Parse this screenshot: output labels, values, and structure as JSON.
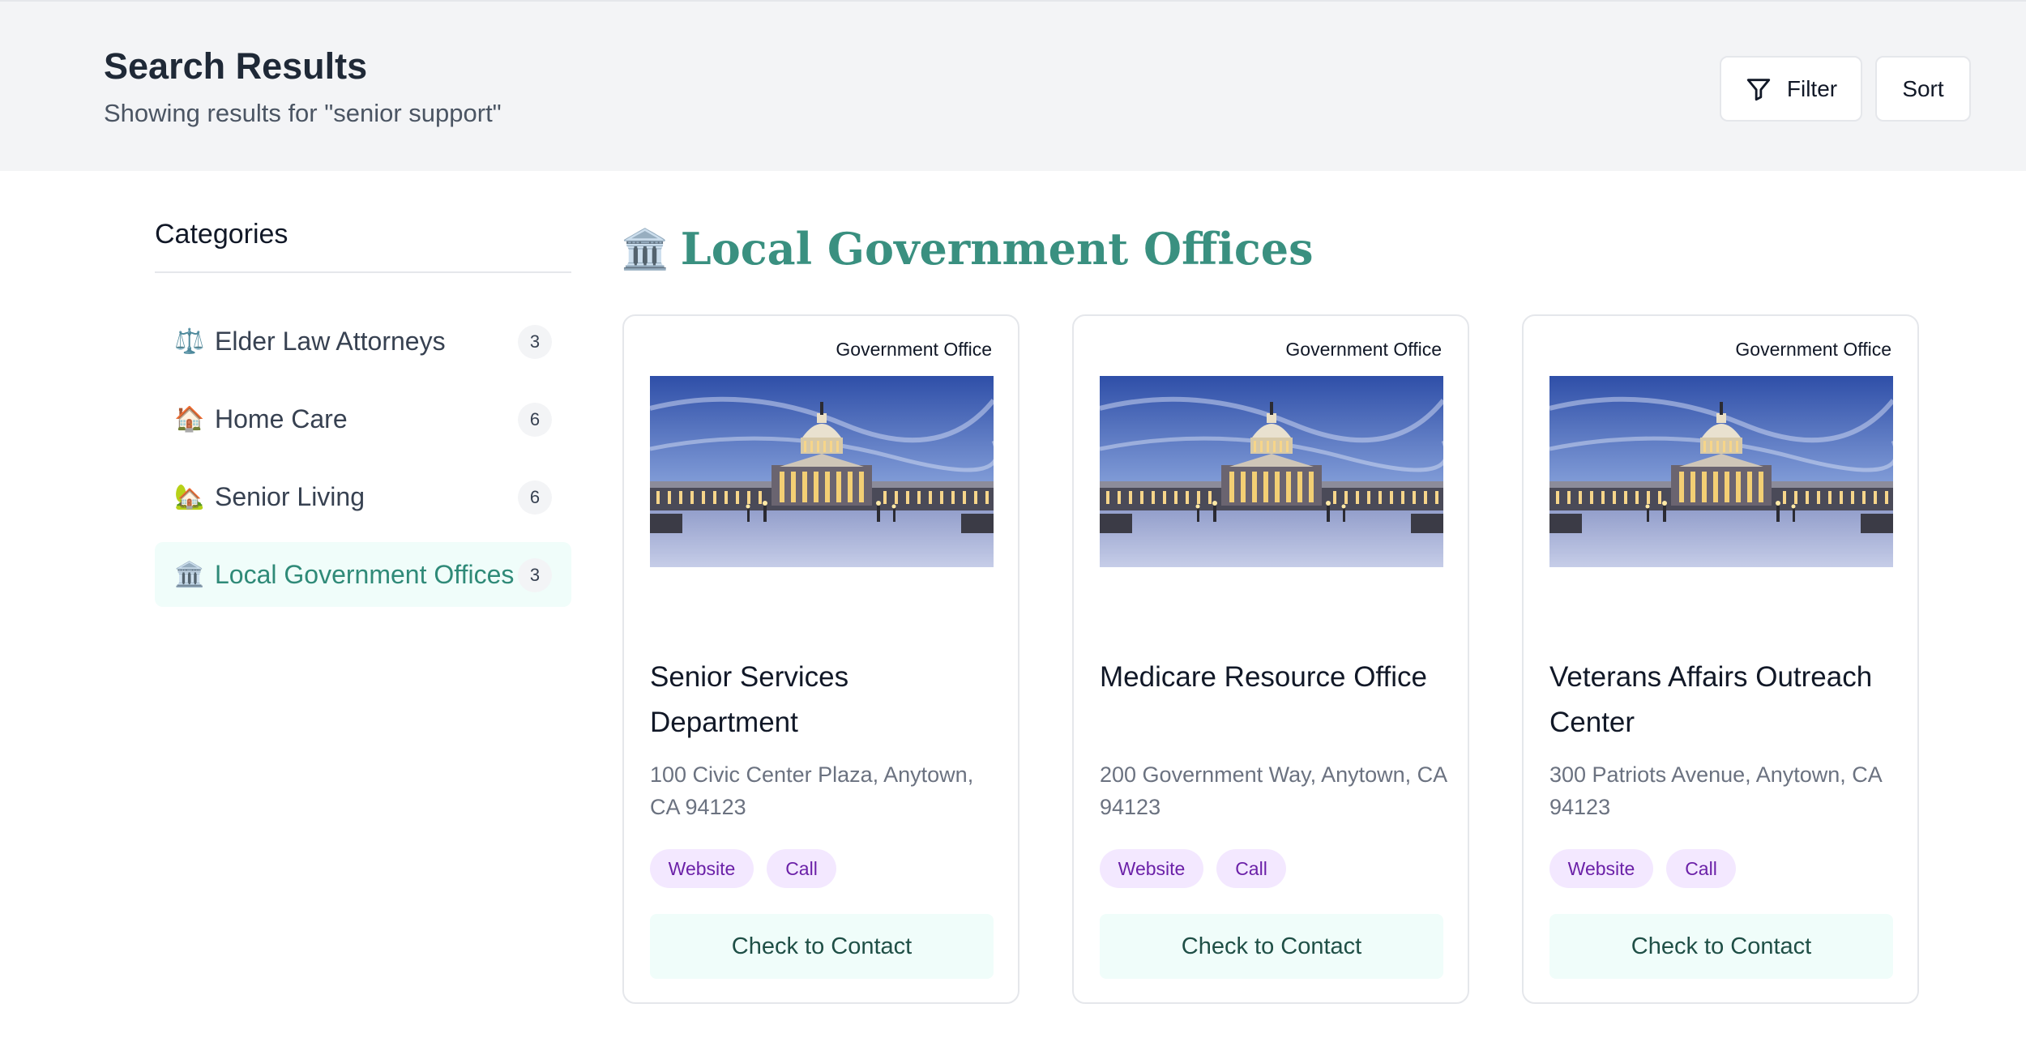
{
  "header": {
    "title": "Search Results",
    "subtitle": "Showing results for \"senior support\"",
    "filter_label": "Filter",
    "sort_label": "Sort"
  },
  "sidebar": {
    "title": "Categories",
    "items": [
      {
        "icon": "⚖️",
        "icon_name": "scales-icon",
        "label": "Elder Law Attorneys",
        "count": "3"
      },
      {
        "icon": "🏠",
        "icon_name": "house-icon",
        "label": "Home Care",
        "count": "6"
      },
      {
        "icon": "🏡",
        "icon_name": "house-garden-icon",
        "label": "Senior Living",
        "count": "6"
      },
      {
        "icon": "🏛️",
        "icon_name": "government-building-icon",
        "label": "Local Government Offices",
        "count": "3",
        "active": true
      }
    ]
  },
  "section": {
    "icon": "🏛️",
    "title": "Local Government Offices"
  },
  "cards": [
    {
      "tag": "Government Office",
      "name": "Senior Services Department",
      "address": "100 Civic Center Plaza, Anytown, CA 94123",
      "website_label": "Website",
      "call_label": "Call",
      "button_label": "Check to Contact"
    },
    {
      "tag": "Government Office",
      "name": "Medicare Resource Office",
      "address": "200 Government Way, Anytown, CA 94123",
      "website_label": "Website",
      "call_label": "Call",
      "button_label": "Check to Contact"
    },
    {
      "tag": "Government Office",
      "name": "Veterans Affairs Outreach Center",
      "address": "300 Patriots Avenue, Anytown, CA 94123",
      "website_label": "Website",
      "call_label": "Call",
      "button_label": "Check to Contact"
    }
  ],
  "colors": {
    "accent": "#3a9080",
    "active_bg": "#f0fdfa",
    "pill_bg": "#f3e8ff",
    "pill_text": "#6b21a8"
  }
}
